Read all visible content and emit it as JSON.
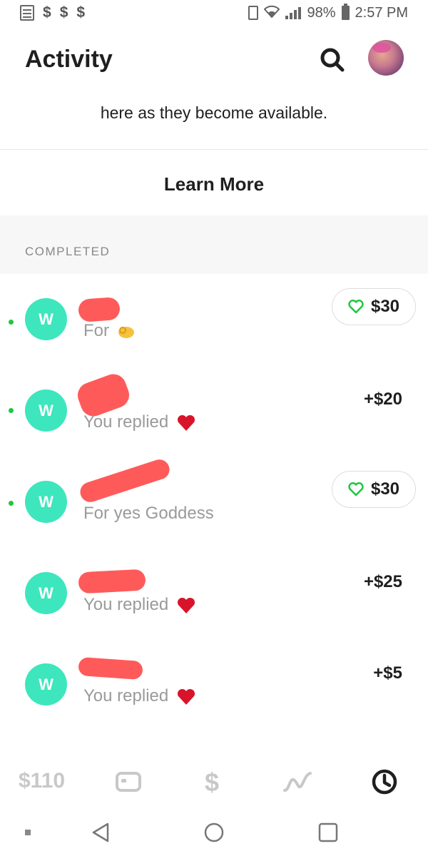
{
  "status_bar": {
    "dollar_icons": [
      "$",
      "$",
      "$"
    ],
    "battery": "98%",
    "time": "2:57 PM"
  },
  "header": {
    "title": "Activity"
  },
  "info": {
    "text": "here as they become available."
  },
  "learn_more": "Learn More",
  "section": {
    "label": "COMPLETED"
  },
  "activity": [
    {
      "avatar_letter": "W",
      "note": "For",
      "amount": "$30",
      "liked": true,
      "unread": true,
      "emoji": "ok-hand"
    },
    {
      "avatar_letter": "W",
      "note": "You replied",
      "amount": "+$20",
      "liked": false,
      "unread": true,
      "emoji": "heart"
    },
    {
      "avatar_letter": "W",
      "note": "For yes Goddess",
      "amount": "$30",
      "liked": true,
      "unread": true,
      "emoji": ""
    },
    {
      "avatar_letter": "W",
      "note": "You replied",
      "amount": "+$25",
      "liked": false,
      "unread": false,
      "emoji": "heart"
    },
    {
      "avatar_letter": "W",
      "note": "You replied",
      "amount": "+$5",
      "liked": false,
      "unread": false,
      "emoji": "heart"
    }
  ],
  "tab_bar": {
    "balance": "$110",
    "tabs": [
      "card-icon",
      "dollar-icon",
      "investing-icon",
      "activity-clock-icon"
    ],
    "active_tab": "activity-clock-icon"
  },
  "colors": {
    "accent_green": "#1ec73e",
    "avatar_teal": "#3ee6bd",
    "redaction": "#ff5a5a"
  }
}
